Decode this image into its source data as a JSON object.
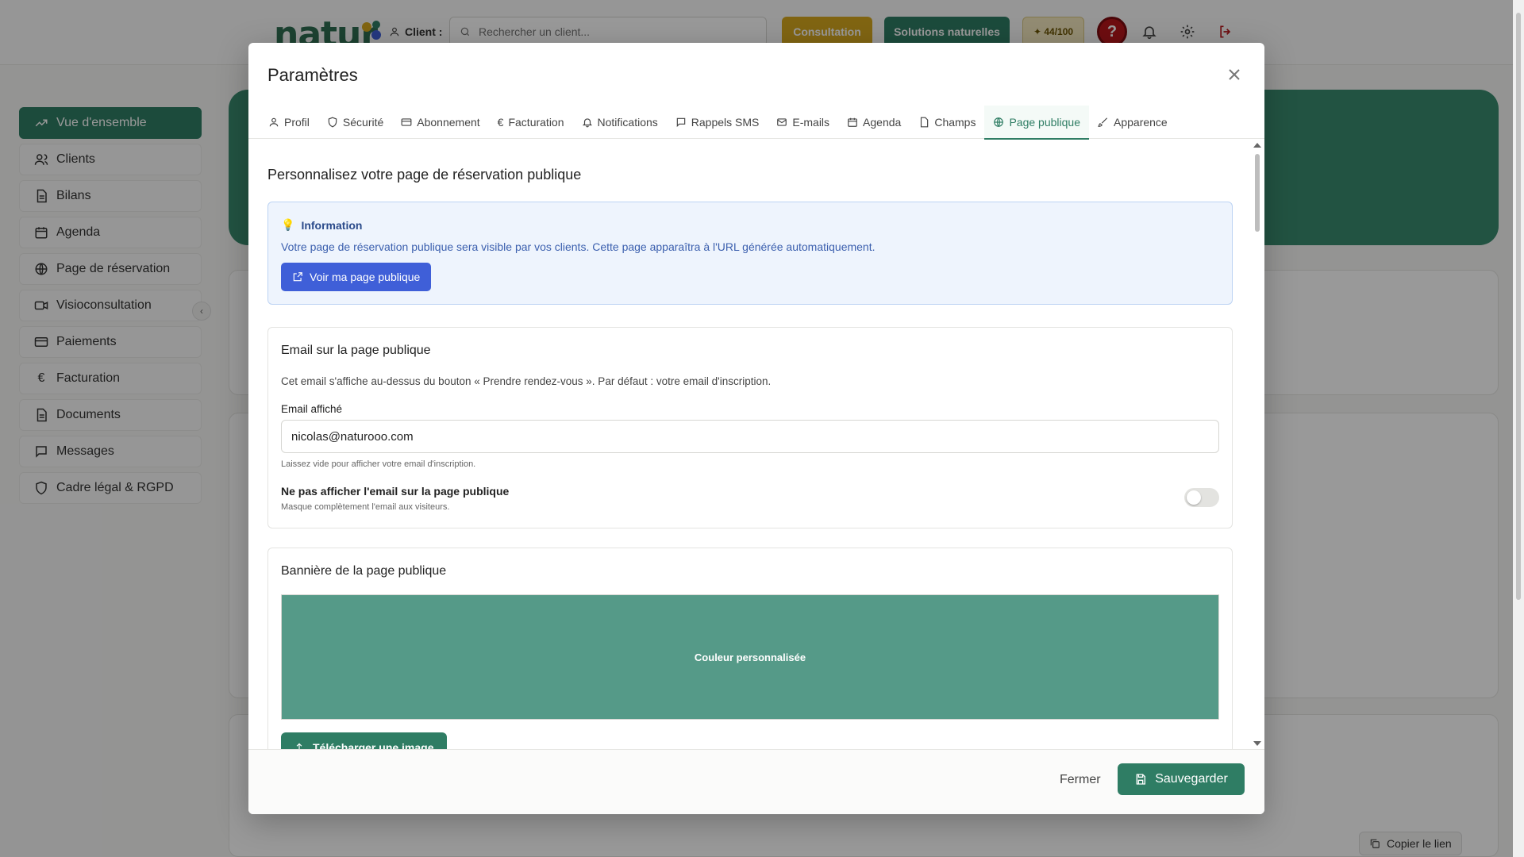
{
  "topbar": {
    "logo_text": "natur",
    "client_label": "Client :",
    "search_placeholder": "Rechercher un client...",
    "consultation_label": "Consultation",
    "solutions_label": "Solutions naturelles",
    "score_label": "44/100"
  },
  "sidebar": {
    "items": [
      {
        "label": "Vue d'ensemble",
        "icon": "trending-up-icon",
        "active": true
      },
      {
        "label": "Clients",
        "icon": "users-icon",
        "active": false
      },
      {
        "label": "Bilans",
        "icon": "file-text-icon",
        "active": false
      },
      {
        "label": "Agenda",
        "icon": "calendar-icon",
        "active": false
      },
      {
        "label": "Page de réservation",
        "icon": "globe-icon",
        "active": false
      },
      {
        "label": "Visioconsultation",
        "icon": "video-icon",
        "active": false
      },
      {
        "label": "Paiements",
        "icon": "credit-card-icon",
        "active": false
      },
      {
        "label": "Facturation",
        "icon": "euro-icon",
        "active": false
      },
      {
        "label": "Documents",
        "icon": "file-icon",
        "active": false
      },
      {
        "label": "Messages",
        "icon": "message-icon",
        "active": false
      },
      {
        "label": "Cadre légal & RGPD",
        "icon": "shield-icon",
        "active": false
      }
    ]
  },
  "background": {
    "copy_link_label": "Copier le lien"
  },
  "modal": {
    "title": "Paramètres",
    "tabs": [
      {
        "label": "Profil",
        "icon": "user-icon",
        "active": false
      },
      {
        "label": "Sécurité",
        "icon": "shield-icon",
        "active": false
      },
      {
        "label": "Abonnement",
        "icon": "card-icon",
        "active": false
      },
      {
        "label": "Facturation",
        "icon": "euro-icon",
        "active": false
      },
      {
        "label": "Notifications",
        "icon": "bell-icon",
        "active": false
      },
      {
        "label": "Rappels SMS",
        "icon": "message-icon",
        "active": false
      },
      {
        "label": "E-mails",
        "icon": "mail-icon",
        "active": false
      },
      {
        "label": "Agenda",
        "icon": "calendar-icon",
        "active": false
      },
      {
        "label": "Champs",
        "icon": "file-icon",
        "active": false
      },
      {
        "label": "Page publique",
        "icon": "globe-icon",
        "active": true
      },
      {
        "label": "Apparence",
        "icon": "brush-icon",
        "active": false
      }
    ],
    "section_title": "Personnalisez votre page de réservation publique",
    "info": {
      "title": "Information",
      "text": "Votre page de réservation publique sera visible par vos clients. Cette page apparaîtra à l'URL générée automatiquement.",
      "button_label": "Voir ma page publique"
    },
    "email_card": {
      "title": "Email sur la page publique",
      "description": "Cet email s'affiche au-dessus du bouton « Prendre rendez-vous ». Par défaut : votre email d'inscription.",
      "field_label": "Email affiché",
      "field_value": "nicolas@naturooo.com",
      "field_hint": "Laissez vide pour afficher votre email d'inscription.",
      "toggle_label": "Ne pas afficher l'email sur la page publique",
      "toggle_hint": "Masque complètement l'email aux visiteurs.",
      "toggle_on": false
    },
    "banner_card": {
      "title": "Bannière de la page publique",
      "preview_label": "Couleur personnalisée",
      "preview_color": "#559a88",
      "upload_label": "Télécharger une image"
    },
    "footer": {
      "close_label": "Fermer",
      "save_label": "Sauvegarder"
    }
  },
  "colors": {
    "brand_green": "#2f7d64",
    "info_blue": "#3f5fd8",
    "gold": "#d7a91f",
    "danger": "#b8161c"
  }
}
